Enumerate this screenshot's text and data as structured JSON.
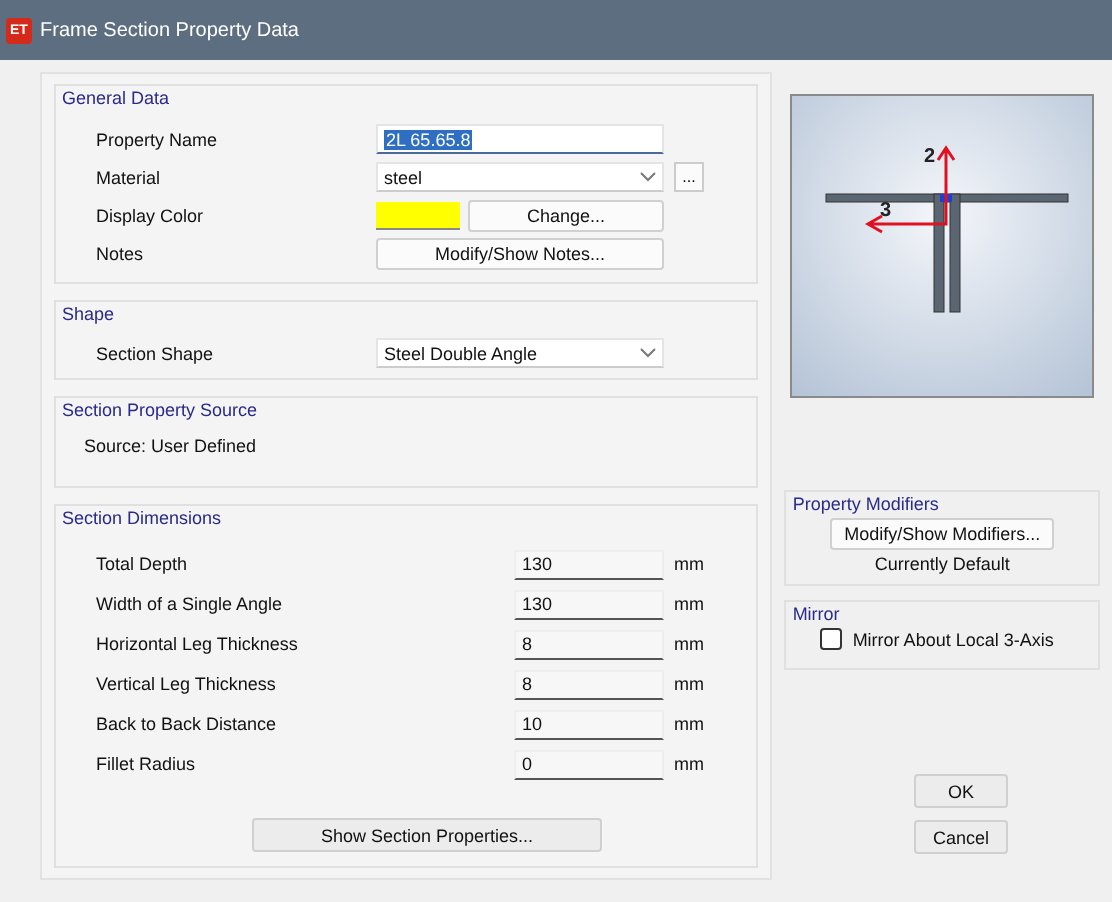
{
  "window": {
    "title": "Frame Section Property Data",
    "app_badge": "ET"
  },
  "general_data": {
    "title": "General Data",
    "property_name": {
      "label": "Property Name",
      "value": "2L 65.65.8"
    },
    "material": {
      "label": "Material",
      "value": "steel",
      "more_button": "..."
    },
    "display_color": {
      "label": "Display Color",
      "color": "#ffff00",
      "button": "Change..."
    },
    "notes": {
      "label": "Notes",
      "button": "Modify/Show Notes..."
    }
  },
  "shape": {
    "title": "Shape",
    "label": "Section Shape",
    "value": "Steel Double Angle"
  },
  "source": {
    "title": "Section Property Source",
    "text": "Source:  User Defined"
  },
  "dimensions": {
    "title": "Section Dimensions",
    "rows": [
      {
        "label": "Total Depth",
        "value": "130",
        "unit": "mm"
      },
      {
        "label": "Width of a Single Angle",
        "value": "130",
        "unit": "mm"
      },
      {
        "label": "Horizontal Leg Thickness",
        "value": "8",
        "unit": "mm"
      },
      {
        "label": "Vertical Leg Thickness",
        "value": "8",
        "unit": "mm"
      },
      {
        "label": "Back to Back Distance",
        "value": "10",
        "unit": "mm"
      },
      {
        "label": "Fillet Radius",
        "value": "0",
        "unit": "mm"
      }
    ],
    "button": "Show Section Properties..."
  },
  "preview": {
    "axis_labels": [
      "2",
      "3"
    ]
  },
  "modifiers": {
    "title": "Property Modifiers",
    "button": "Modify/Show Modifiers...",
    "status": "Currently Default"
  },
  "mirror": {
    "title": "Mirror",
    "label": "Mirror About Local 3-Axis",
    "checked": false
  },
  "buttons": [
    "OK",
    "Cancel"
  ]
}
